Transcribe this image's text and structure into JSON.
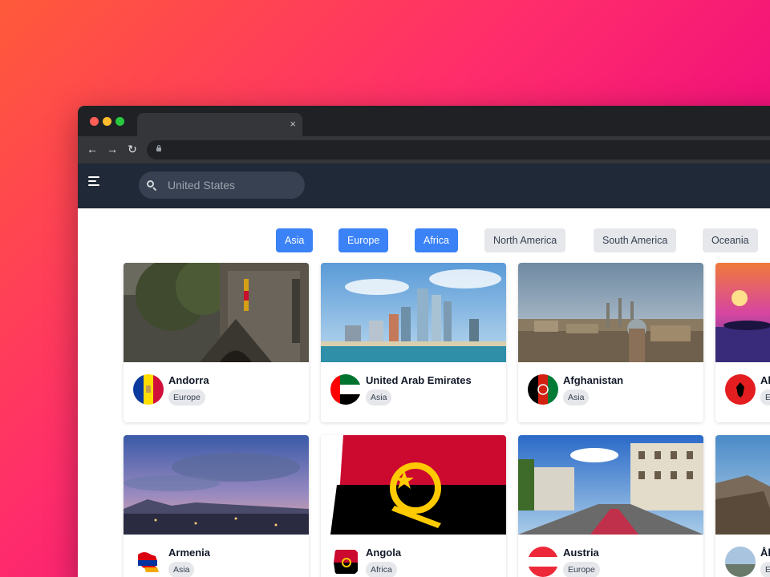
{
  "browser": {
    "tab_close": "×",
    "nav_back": "←",
    "nav_forward": "→",
    "nav_reload": "↻"
  },
  "search": {
    "placeholder": "United States"
  },
  "filters": [
    {
      "label": "Asia",
      "active": true
    },
    {
      "label": "Europe",
      "active": true
    },
    {
      "label": "Africa",
      "active": true
    },
    {
      "label": "North America",
      "active": false
    },
    {
      "label": "South America",
      "active": false
    },
    {
      "label": "Oceania",
      "active": false
    }
  ],
  "countries": [
    {
      "name": "Andorra",
      "region": "Europe"
    },
    {
      "name": "United Arab Emirates",
      "region": "Asia"
    },
    {
      "name": "Afghanistan",
      "region": "Asia"
    },
    {
      "name": "Al",
      "region": "E"
    },
    {
      "name": "Armenia",
      "region": "Asia"
    },
    {
      "name": "Angola",
      "region": "Africa"
    },
    {
      "name": "Austria",
      "region": "Europe"
    },
    {
      "name": "Ål",
      "region": "E"
    }
  ],
  "colors": {
    "header_bg": "#1f2937",
    "filter_active": "#3b82f6",
    "filter_inactive": "#e5e7eb"
  },
  "icons": {
    "menu": "menu-icon",
    "search": "search-icon",
    "lock": "lock-icon",
    "close": "close-icon"
  }
}
